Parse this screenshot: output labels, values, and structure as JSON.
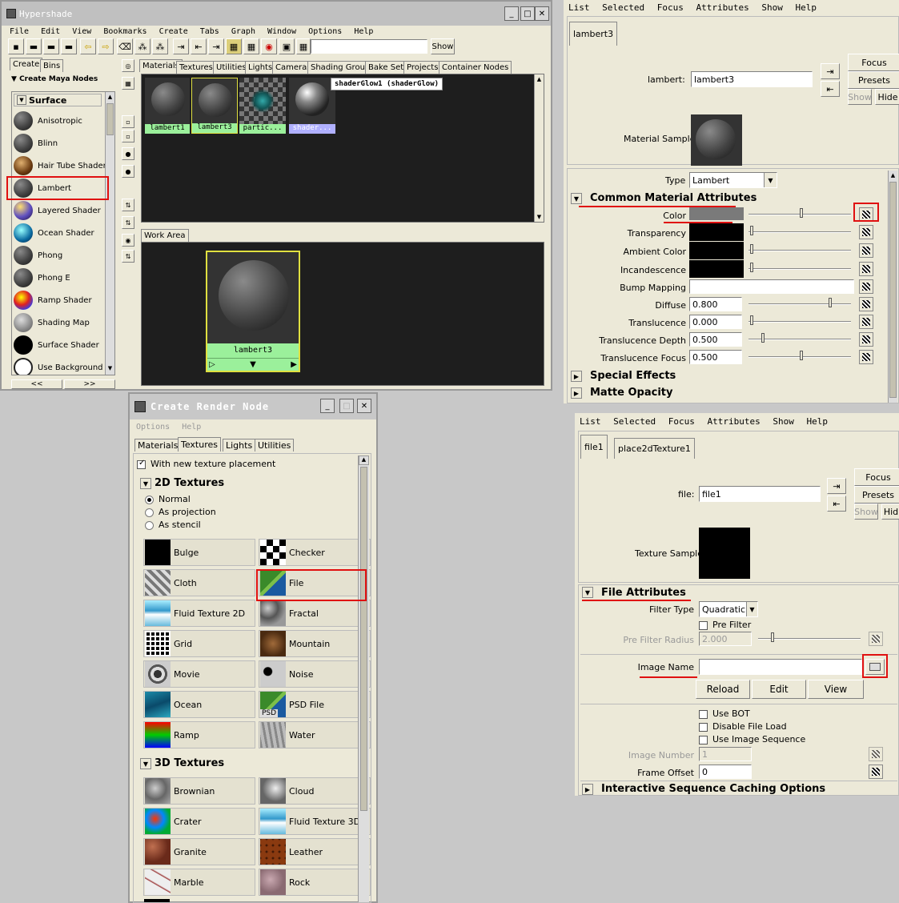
{
  "hypershade": {
    "title": "Hypershade",
    "menu": [
      "File",
      "Edit",
      "View",
      "Bookmarks",
      "Create",
      "Tabs",
      "Graph",
      "Window",
      "Options",
      "Help"
    ],
    "show_label": "Show",
    "left_tabs": [
      "Create",
      "Bins"
    ],
    "create_header": "Create Maya Nodes",
    "surface_header": "Surface",
    "nodes": [
      "Anisotropic",
      "Blinn",
      "Hair Tube Shader",
      "Lambert",
      "Layered Shader",
      "Ocean Shader",
      "Phong",
      "Phong E",
      "Ramp Shader",
      "Shading Map",
      "Surface Shader",
      "Use Background"
    ],
    "nav": [
      "<<",
      ">>"
    ],
    "tabs": [
      "Materials",
      "Textures",
      "Utilities",
      "Lights",
      "Cameras",
      "Shading Groups",
      "Bake Sets",
      "Projects",
      "Container Nodes"
    ],
    "swatches": [
      "lambert1",
      "lambert3",
      "partic...",
      "shader..."
    ],
    "tooltip": "shaderGlow1 (shaderGlow)",
    "work_area_tab": "Work Area",
    "work_node": "lambert3"
  },
  "attr_lambert": {
    "menu": [
      "List",
      "Selected",
      "Focus",
      "Attributes",
      "Show",
      "Help"
    ],
    "tab": "lambert3",
    "name_label": "lambert:",
    "name_value": "lambert3",
    "buttons": [
      "Focus",
      "Presets",
      "Show",
      "Hide"
    ],
    "sample_label": "Material Sample",
    "type_label": "Type",
    "type_value": "Lambert",
    "section_common": "Common Material Attributes",
    "rows": [
      {
        "label": "Color",
        "value": ""
      },
      {
        "label": "Transparency",
        "value": ""
      },
      {
        "label": "Ambient Color",
        "value": ""
      },
      {
        "label": "Incandescence",
        "value": ""
      },
      {
        "label": "Bump Mapping",
        "value": ""
      },
      {
        "label": "Diffuse",
        "value": "0.800"
      },
      {
        "label": "Translucence",
        "value": "0.000"
      },
      {
        "label": "Translucence Depth",
        "value": "0.500"
      },
      {
        "label": "Translucence Focus",
        "value": "0.500"
      }
    ],
    "section_special": "Special Effects",
    "section_matte": "Matte Opacity"
  },
  "render_node": {
    "title": "Create Render Node",
    "menu": [
      "Options",
      "Help"
    ],
    "tabs": [
      "Materials",
      "Textures",
      "Lights",
      "Utilities"
    ],
    "placement_label": "With new texture placement",
    "section_2d": "2D Textures",
    "radios": [
      "Normal",
      "As projection",
      "As stencil"
    ],
    "textures_2d": [
      "Bulge",
      "Checker",
      "Cloth",
      "File",
      "Fluid Texture 2D",
      "Fractal",
      "Grid",
      "Mountain",
      "Movie",
      "Noise",
      "Ocean",
      "PSD File",
      "Ramp",
      "Water"
    ],
    "section_3d": "3D Textures",
    "textures_3d": [
      "Brownian",
      "Cloud",
      "Crater",
      "Fluid Texture 3D",
      "Granite",
      "Leather",
      "Marble",
      "Rock"
    ],
    "psd_badge": "PSD"
  },
  "attr_file": {
    "menu": [
      "List",
      "Selected",
      "Focus",
      "Attributes",
      "Show",
      "Help"
    ],
    "tabs": [
      "file1",
      "place2dTexture1"
    ],
    "name_label": "file:",
    "name_value": "file1",
    "buttons": [
      "Focus",
      "Presets",
      "Show",
      "Hid"
    ],
    "sample_label": "Texture Sample",
    "section_file": "File Attributes",
    "filter_type_label": "Filter Type",
    "filter_type_value": "Quadratic",
    "pre_filter_label": "Pre Filter",
    "pre_filter_radius_label": "Pre Filter Radius",
    "pre_filter_radius_value": "2.000",
    "image_name_label": "Image Name",
    "image_name_value": "",
    "action_buttons": [
      "Reload",
      "Edit",
      "View"
    ],
    "checks": [
      "Use BOT",
      "Disable File Load",
      "Use Image Sequence"
    ],
    "image_number_label": "Image Number",
    "image_number_value": "1",
    "frame_offset_label": "Frame Offset",
    "frame_offset_value": "0",
    "section_caching": "Interactive Sequence Caching Options"
  },
  "colors": {
    "highlight_red": "#e01010",
    "swatch_green": "#9bf09b",
    "panel_bg": "#ece9d8",
    "dark_bg": "#1e1e1e"
  }
}
